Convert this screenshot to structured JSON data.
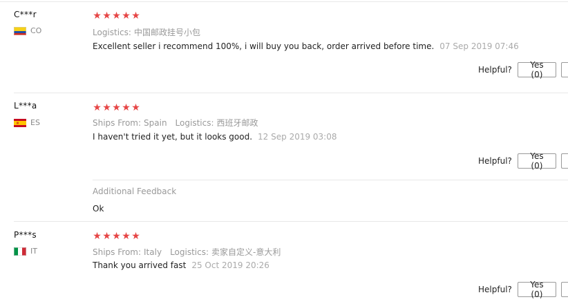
{
  "reviews": [
    {
      "user": "C***r",
      "country": "CO",
      "flag": "co",
      "rating": 5,
      "ships_from_label": "",
      "ships_from": "",
      "logistics_label": "Logistics:",
      "logistics": "中国邮政挂号小包",
      "text": "Excellent seller i recommend 100%, i will buy you back, order arrived before time.",
      "date": "07 Sep 2019 07:46",
      "helpful_label": "Helpful?",
      "yes_label": "Yes (0)"
    },
    {
      "user": "L***a",
      "country": "ES",
      "flag": "es",
      "rating": 5,
      "ships_from_label": "Ships From:",
      "ships_from": "Spain",
      "logistics_label": "Logistics:",
      "logistics": "西班牙邮政",
      "text": "I haven't tried it yet, but it looks good.",
      "date": "12 Sep 2019 03:08",
      "helpful_label": "Helpful?",
      "yes_label": "Yes (0)",
      "additional_label": "Additional Feedback",
      "additional_text": "Ok"
    },
    {
      "user": "P***s",
      "country": "IT",
      "flag": "it",
      "rating": 5,
      "ships_from_label": "Ships From:",
      "ships_from": "Italy",
      "logistics_label": "Logistics:",
      "logistics": "卖家自定义-意大利",
      "text": "Thank you arrived fast",
      "date": "25 Oct 2019 20:26",
      "helpful_label": "Helpful?",
      "yes_label": "Yes (0)"
    }
  ],
  "colors": {
    "star": "#e64545",
    "muted": "#999999",
    "divider": "#e8e8e8"
  }
}
